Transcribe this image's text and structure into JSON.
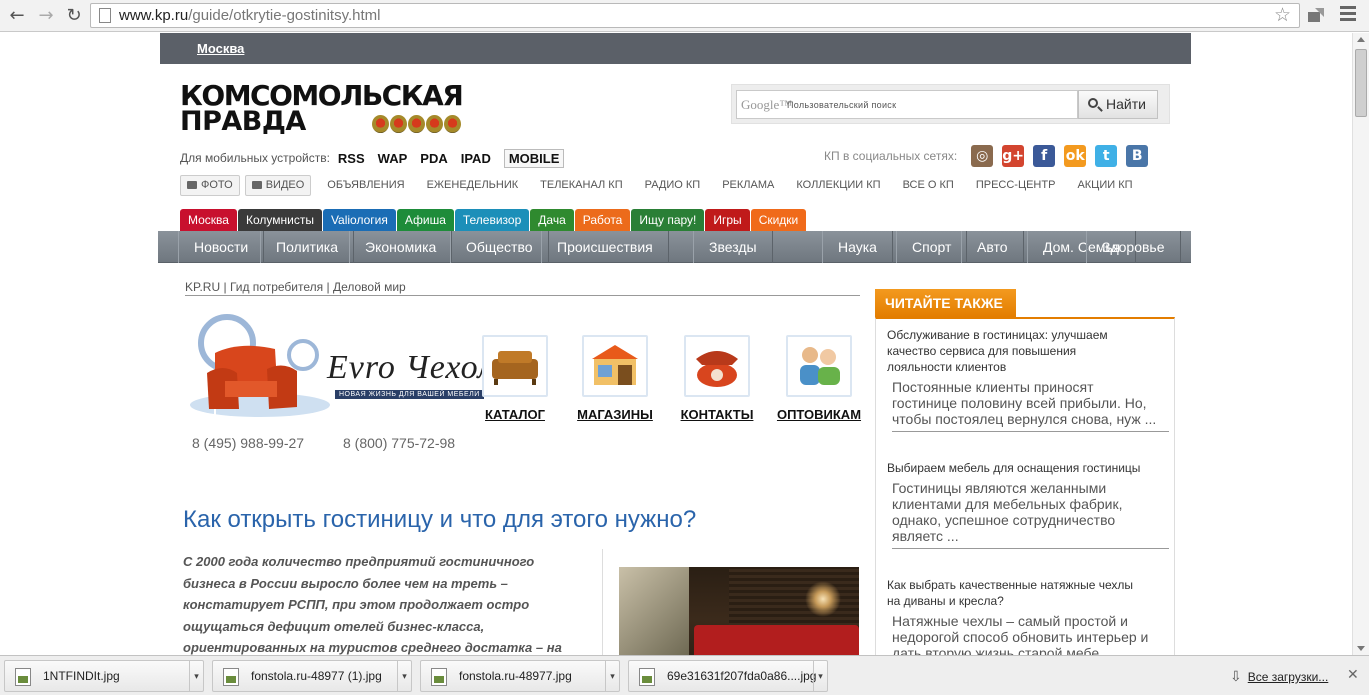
{
  "browser": {
    "url_host": "www.kp.ru",
    "url_path": "/guide/otkrytie-gostinitsy.html"
  },
  "site": {
    "city": "Москва",
    "logo_line1": "КОМСОМОЛЬСКАЯ",
    "logo_line2": "ПРАВДА",
    "search": {
      "google_label": "Google™",
      "placeholder": "Пользовательский поиск",
      "button": "Найти"
    },
    "mobile": {
      "label": "Для мобильных устройств:",
      "options": [
        "RSS",
        "WAP",
        "PDA",
        "IPAD",
        "MOBILE"
      ]
    },
    "social": {
      "label": "КП в социальных сетях:",
      "icons": [
        "instagram-icon",
        "google-plus-icon",
        "facebook-icon",
        "odnoklassniki-icon",
        "twitter-icon",
        "vkontakte-icon"
      ]
    },
    "sections": {
      "photo": "ФОТО",
      "video": "ВИДЕО",
      "items": [
        "ОБЪЯВЛЕНИЯ",
        "ЕЖЕНЕДЕЛЬНИК",
        "ТЕЛЕКАНАЛ КП",
        "РАДИО КП",
        "РЕКЛАМА",
        "КОЛЛЕКЦИИ КП",
        "ВСЕ О КП",
        "ПРЕСС-ЦЕНТР",
        "АКЦИИ КП"
      ]
    },
    "color_tabs": [
      {
        "label": "Москва",
        "color": "#c8102e"
      },
      {
        "label": "Колумнисты",
        "color": "#3a3a3a"
      },
      {
        "label": "Valiология",
        "color": "#1b6db5"
      },
      {
        "label": "Афиша",
        "color": "#1e8c3a"
      },
      {
        "label": "Телевизор",
        "color": "#1c8fb9"
      },
      {
        "label": "Дача",
        "color": "#2f8a2f"
      },
      {
        "label": "Работа",
        "color": "#ec6b1b"
      },
      {
        "label": "Ищу пару!",
        "color": "#2a7f36"
      },
      {
        "label": "Игры",
        "color": "#c01a1a"
      },
      {
        "label": "Скидки",
        "color": "#f06a1a"
      }
    ],
    "main_nav": [
      "Новости",
      "Политика",
      "Экономика",
      "Общество",
      "Происшествия",
      "Звезды",
      "Наука",
      "Спорт",
      "Авто",
      "Дом. Семья",
      "Здоровье"
    ]
  },
  "breadcrumb": [
    "KP.RU",
    "Гид потребителя",
    "Деловой мир"
  ],
  "ad": {
    "brand": "Evro Чехол",
    "tagline": "НОВАЯ ЖИЗНЬ ДЛЯ ВАШЕЙ МЕБЕЛИ",
    "phone1": "8 (495) 988-99-27",
    "phone2": "8 (800) 775-72-98",
    "buttons": [
      "КАТАЛОГ",
      "МАГАЗИНЫ",
      "КОНТАКТЫ",
      "ОПТОВИКАМ"
    ]
  },
  "article": {
    "title": "Как открыть гостиницу и что для этого нужно?",
    "lead_lines": [
      "С 2000 года количество предприятий гостиничного",
      "бизнеса в России выросло более чем на треть –",
      "констатирует РСПП, при этом продолжает остро",
      "ощущаться дефицит отелей бизнес-класса,",
      "ориентированных на туристов среднего достатка – на"
    ]
  },
  "sidebar": {
    "caption": "ЧИТАЙТЕ ТАКЖЕ",
    "items": [
      {
        "title_lines": [
          "Обслуживание в гостиницах: улучшаем",
          "качество сервиса для повышения",
          "лояльности клиентов"
        ],
        "desc_lines": [
          "Постоянные клиенты приносят",
          "гостинице половину всей прибыли. Но,",
          "чтобы постоялец вернулся снова, нуж ..."
        ]
      },
      {
        "title_lines": [
          "Выбираем мебель для оснащения гостиницы"
        ],
        "desc_lines": [
          "Гостиницы являются желанными",
          "клиентами для мебельных фабрик,",
          "однако, успешное сотрудничество",
          "являетс ..."
        ]
      },
      {
        "title_lines": [
          "Как выбрать качественные натяжные чехлы",
          "на диваны и кресла?"
        ],
        "desc_lines": [
          "Натяжные чехлы – самый простой и",
          "недорогой способ обновить интерьер и",
          "дать вторую жизнь старой мебе..."
        ]
      }
    ]
  },
  "downloads": {
    "files": [
      "1NTFINDIt.jpg",
      "fonstola.ru-48977 (1).jpg",
      "fonstola.ru-48977.jpg",
      "69e31631f207fda0a86....jpg"
    ],
    "all_label": "Все загрузки..."
  }
}
